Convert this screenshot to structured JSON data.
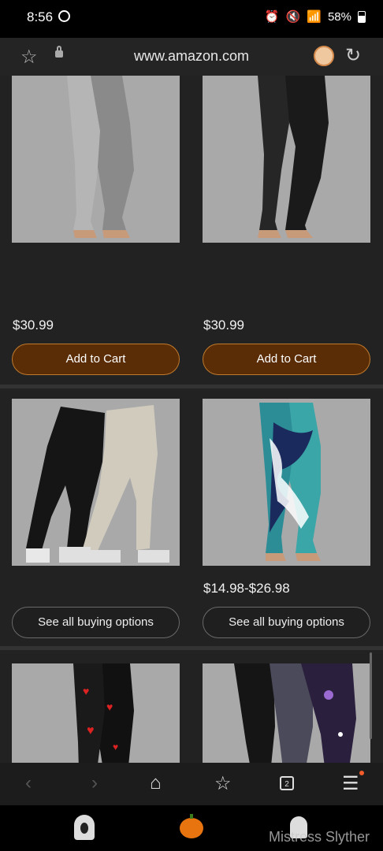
{
  "status_bar": {
    "time": "8:56",
    "battery": "58%"
  },
  "browser": {
    "url": "www.amazon.com"
  },
  "products": [
    {
      "price": "$30.99",
      "button": "Add to Cart"
    },
    {
      "price": "$30.99",
      "button": "Add to Cart"
    },
    {
      "price": "",
      "button": "See all buying options"
    },
    {
      "price": "$14.98-$26.98",
      "button": "See all buying options"
    },
    {
      "price": "",
      "button": ""
    },
    {
      "price": "",
      "button": ""
    }
  ],
  "bottom_nav": {
    "tab_count": "2"
  },
  "watermark": "Mistress Slyther",
  "colors": {
    "cart_button_bg": "#5a2d06",
    "cart_button_border": "#c17a2c",
    "page_bg": "#222222",
    "thumb_bg": "#a9a9a9"
  }
}
